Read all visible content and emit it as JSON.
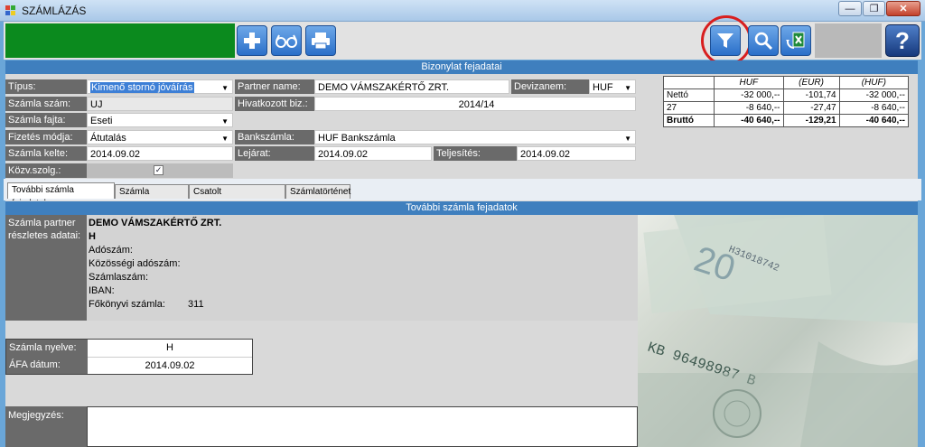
{
  "window": {
    "title": "SZÁMLÁZÁS",
    "minimize": "—",
    "restore": "❐",
    "close": "✕"
  },
  "toolbar": {
    "add_icon": "plus-icon",
    "view_icon": "glasses-icon",
    "print_icon": "printer-icon",
    "filter_icon": "filter-icon",
    "search_icon": "search-icon",
    "export_icon": "excel-export-icon",
    "help_label": "?"
  },
  "colors": {
    "accent_green": "#0b8a1e",
    "header_blue": "#3f7fbe",
    "highlight_red": "#d81f1f"
  },
  "header": {
    "title": "Bizonylat fejadatai"
  },
  "form": {
    "tipus_label": "Típus:",
    "tipus_value": "Kimenő stornó jóváírás",
    "szamla_szam_label": "Számla szám:",
    "szamla_szam_value": "UJ",
    "szamla_fajta_label": "Számla fajta:",
    "szamla_fajta_value": "Eseti",
    "fizetes_label": "Fizetés módja:",
    "fizetes_value": "Átutalás",
    "kelte_label": "Számla kelte:",
    "kelte_value": "2014.09.02",
    "kozv_label": "Közv.szolg.:",
    "kozv_checked": "✓",
    "partner_label": "Partner name:",
    "partner_value": "DEMO VÁMSZAKÉRTŐ ZRT.",
    "hivatkozott_label": "Hivatkozott biz.:",
    "hivatkozott_value": "2014/14",
    "deviza_label": "Devizanem:",
    "deviza_value": "HUF",
    "bank_label": "Bankszámla:",
    "bank_value": "HUF Bankszámla",
    "lejarat_label": "Lejárat:",
    "lejarat_value": "2014.09.02",
    "teljesites_label": "Teljesítés:",
    "teljesites_value": "2014.09.02"
  },
  "totals": {
    "headers": [
      "HUF",
      "(EUR)",
      "(HUF)"
    ],
    "rows": [
      {
        "label": "Nettó",
        "values": [
          "-32 000,--",
          "-101,74",
          "-32 000,--"
        ]
      },
      {
        "label": "27",
        "values": [
          "-8 640,--",
          "-27,47",
          "-8 640,--"
        ]
      },
      {
        "label": "Bruttó",
        "values": [
          "-40 640,--",
          "-129,21",
          "-40 640,--"
        ]
      }
    ]
  },
  "tabs": [
    {
      "label": "További számla fejadatok"
    },
    {
      "label": "Számla tételsorok"
    },
    {
      "label": "Csatolt dokumentumok"
    },
    {
      "label": "Számlatörténet"
    }
  ],
  "panel": {
    "title": "További számla fejadatok",
    "partner_details_label": "Számla partner részletes adatai:",
    "partner_name": "DEMO VÁMSZAKÉRTŐ ZRT.",
    "partner_h": "H",
    "adoszam": "Adószám:",
    "kozossegi": "Közösségi adószám:",
    "szamlaszam": "Számlaszám:",
    "iban": "IBAN:",
    "fokonyv_label": "Főkönyvi számla:",
    "fokonyv_value": "311",
    "nyelv_label": "Számla nyelve:",
    "nyelv_value": "H",
    "afa_label": "ÁFA dátum:",
    "afa_value": "2014.09.02",
    "megjegyzes_label": "Megjegyzés:"
  }
}
